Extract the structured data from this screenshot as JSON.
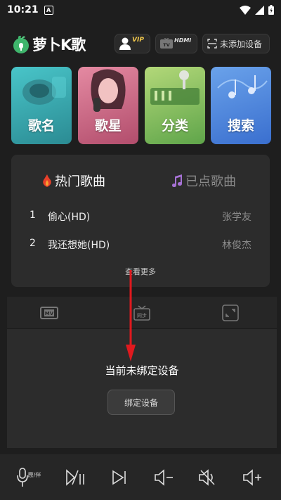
{
  "status_bar": {
    "time": "10:21",
    "notification_badge": "A"
  },
  "header": {
    "logo_text": "萝卜K歌",
    "vip_label": "VIP",
    "hdmi_label": "HDMI",
    "tv_label": "TV",
    "device_button_label": "未添加设备"
  },
  "categories": [
    {
      "label": "歌名",
      "color": "#3aa9b0"
    },
    {
      "label": "歌星",
      "color": "#c9607f"
    },
    {
      "label": "分类",
      "color": "#80bd5a"
    },
    {
      "label": "搜索",
      "color": "#4f86de"
    }
  ],
  "songs_panel": {
    "tab_hot": "热门歌曲",
    "tab_ordered": "已点歌曲",
    "songs": [
      {
        "num": "1",
        "title": "偷心(HD)",
        "artist": "张学友"
      },
      {
        "num": "2",
        "title": "我还想她(HD)",
        "artist": "林俊杰"
      }
    ],
    "more_label": "查看更多"
  },
  "device_panel": {
    "tab_mv": "MV",
    "tab_sync": "同步",
    "unbound_text": "当前未绑定设备",
    "bind_button": "绑定设备"
  },
  "bottom_bar": {
    "vocal_toggle": "原/伴",
    "accent_color": "#ffffff"
  },
  "annotation": {
    "arrow_color": "#e0191e"
  }
}
